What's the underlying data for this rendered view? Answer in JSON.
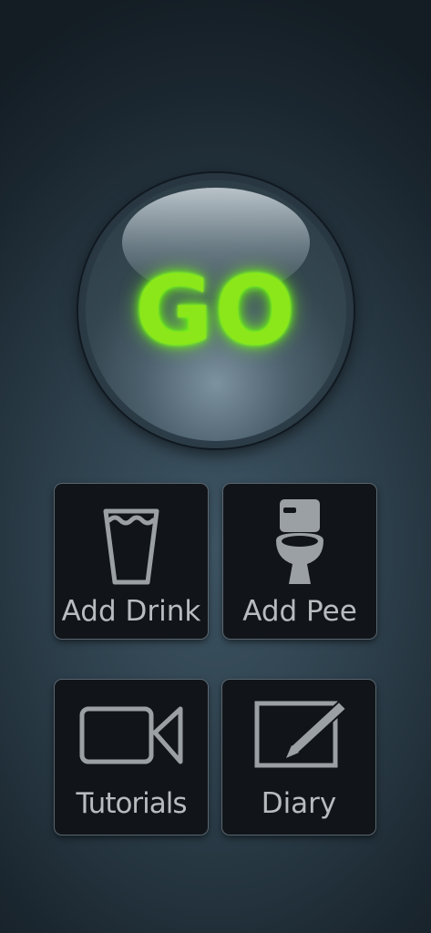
{
  "go_button": {
    "label": "GO"
  },
  "tiles": {
    "add_drink": {
      "label": "Add Drink",
      "icon": "glass-of-water-icon"
    },
    "add_pee": {
      "label": "Add Pee",
      "icon": "toilet-icon"
    },
    "tutorials": {
      "label": "Tutorials",
      "icon": "video-camera-icon"
    },
    "diary": {
      "label": "Diary",
      "icon": "pencil-notepad-icon"
    }
  },
  "colors": {
    "go_text": "#8be61a",
    "tile_background": "#111519",
    "tile_text": "#b8bcbf",
    "icon_stroke": "#9aa0a4"
  }
}
